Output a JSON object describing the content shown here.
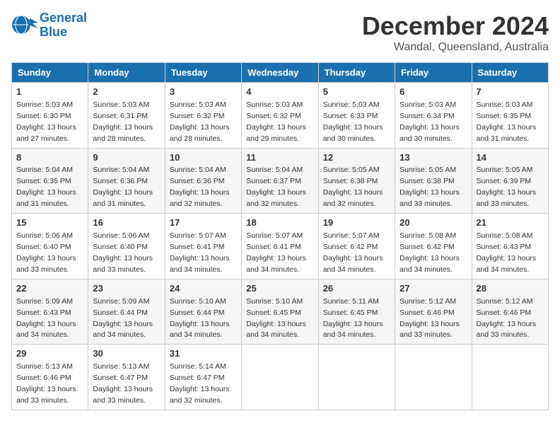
{
  "logo": {
    "line1": "General",
    "line2": "Blue"
  },
  "title": "December 2024",
  "location": "Wandal, Queensland, Australia",
  "days_header": [
    "Sunday",
    "Monday",
    "Tuesday",
    "Wednesday",
    "Thursday",
    "Friday",
    "Saturday"
  ],
  "weeks": [
    [
      {
        "day": "1",
        "sunrise": "5:03 AM",
        "sunset": "6:30 PM",
        "daylight": "13 hours and 27 minutes."
      },
      {
        "day": "2",
        "sunrise": "5:03 AM",
        "sunset": "6:31 PM",
        "daylight": "13 hours and 28 minutes."
      },
      {
        "day": "3",
        "sunrise": "5:03 AM",
        "sunset": "6:32 PM",
        "daylight": "13 hours and 28 minutes."
      },
      {
        "day": "4",
        "sunrise": "5:03 AM",
        "sunset": "6:32 PM",
        "daylight": "13 hours and 29 minutes."
      },
      {
        "day": "5",
        "sunrise": "5:03 AM",
        "sunset": "6:33 PM",
        "daylight": "13 hours and 30 minutes."
      },
      {
        "day": "6",
        "sunrise": "5:03 AM",
        "sunset": "6:34 PM",
        "daylight": "13 hours and 30 minutes."
      },
      {
        "day": "7",
        "sunrise": "5:03 AM",
        "sunset": "6:35 PM",
        "daylight": "13 hours and 31 minutes."
      }
    ],
    [
      {
        "day": "8",
        "sunrise": "5:04 AM",
        "sunset": "6:35 PM",
        "daylight": "13 hours and 31 minutes."
      },
      {
        "day": "9",
        "sunrise": "5:04 AM",
        "sunset": "6:36 PM",
        "daylight": "13 hours and 31 minutes."
      },
      {
        "day": "10",
        "sunrise": "5:04 AM",
        "sunset": "6:36 PM",
        "daylight": "13 hours and 32 minutes."
      },
      {
        "day": "11",
        "sunrise": "5:04 AM",
        "sunset": "6:37 PM",
        "daylight": "13 hours and 32 minutes."
      },
      {
        "day": "12",
        "sunrise": "5:05 AM",
        "sunset": "6:38 PM",
        "daylight": "13 hours and 32 minutes."
      },
      {
        "day": "13",
        "sunrise": "5:05 AM",
        "sunset": "6:38 PM",
        "daylight": "13 hours and 33 minutes."
      },
      {
        "day": "14",
        "sunrise": "5:05 AM",
        "sunset": "6:39 PM",
        "daylight": "13 hours and 33 minutes."
      }
    ],
    [
      {
        "day": "15",
        "sunrise": "5:06 AM",
        "sunset": "6:40 PM",
        "daylight": "13 hours and 33 minutes."
      },
      {
        "day": "16",
        "sunrise": "5:06 AM",
        "sunset": "6:40 PM",
        "daylight": "13 hours and 33 minutes."
      },
      {
        "day": "17",
        "sunrise": "5:07 AM",
        "sunset": "6:41 PM",
        "daylight": "13 hours and 34 minutes."
      },
      {
        "day": "18",
        "sunrise": "5:07 AM",
        "sunset": "6:41 PM",
        "daylight": "13 hours and 34 minutes."
      },
      {
        "day": "19",
        "sunrise": "5:07 AM",
        "sunset": "6:42 PM",
        "daylight": "13 hours and 34 minutes."
      },
      {
        "day": "20",
        "sunrise": "5:08 AM",
        "sunset": "6:42 PM",
        "daylight": "13 hours and 34 minutes."
      },
      {
        "day": "21",
        "sunrise": "5:08 AM",
        "sunset": "6:43 PM",
        "daylight": "13 hours and 34 minutes."
      }
    ],
    [
      {
        "day": "22",
        "sunrise": "5:09 AM",
        "sunset": "6:43 PM",
        "daylight": "13 hours and 34 minutes."
      },
      {
        "day": "23",
        "sunrise": "5:09 AM",
        "sunset": "6:44 PM",
        "daylight": "13 hours and 34 minutes."
      },
      {
        "day": "24",
        "sunrise": "5:10 AM",
        "sunset": "6:44 PM",
        "daylight": "13 hours and 34 minutes."
      },
      {
        "day": "25",
        "sunrise": "5:10 AM",
        "sunset": "6:45 PM",
        "daylight": "13 hours and 34 minutes."
      },
      {
        "day": "26",
        "sunrise": "5:11 AM",
        "sunset": "6:45 PM",
        "daylight": "13 hours and 34 minutes."
      },
      {
        "day": "27",
        "sunrise": "5:12 AM",
        "sunset": "6:46 PM",
        "daylight": "13 hours and 33 minutes."
      },
      {
        "day": "28",
        "sunrise": "5:12 AM",
        "sunset": "6:46 PM",
        "daylight": "13 hours and 33 minutes."
      }
    ],
    [
      {
        "day": "29",
        "sunrise": "5:13 AM",
        "sunset": "6:46 PM",
        "daylight": "13 hours and 33 minutes."
      },
      {
        "day": "30",
        "sunrise": "5:13 AM",
        "sunset": "6:47 PM",
        "daylight": "13 hours and 33 minutes."
      },
      {
        "day": "31",
        "sunrise": "5:14 AM",
        "sunset": "6:47 PM",
        "daylight": "13 hours and 32 minutes."
      },
      null,
      null,
      null,
      null
    ]
  ]
}
